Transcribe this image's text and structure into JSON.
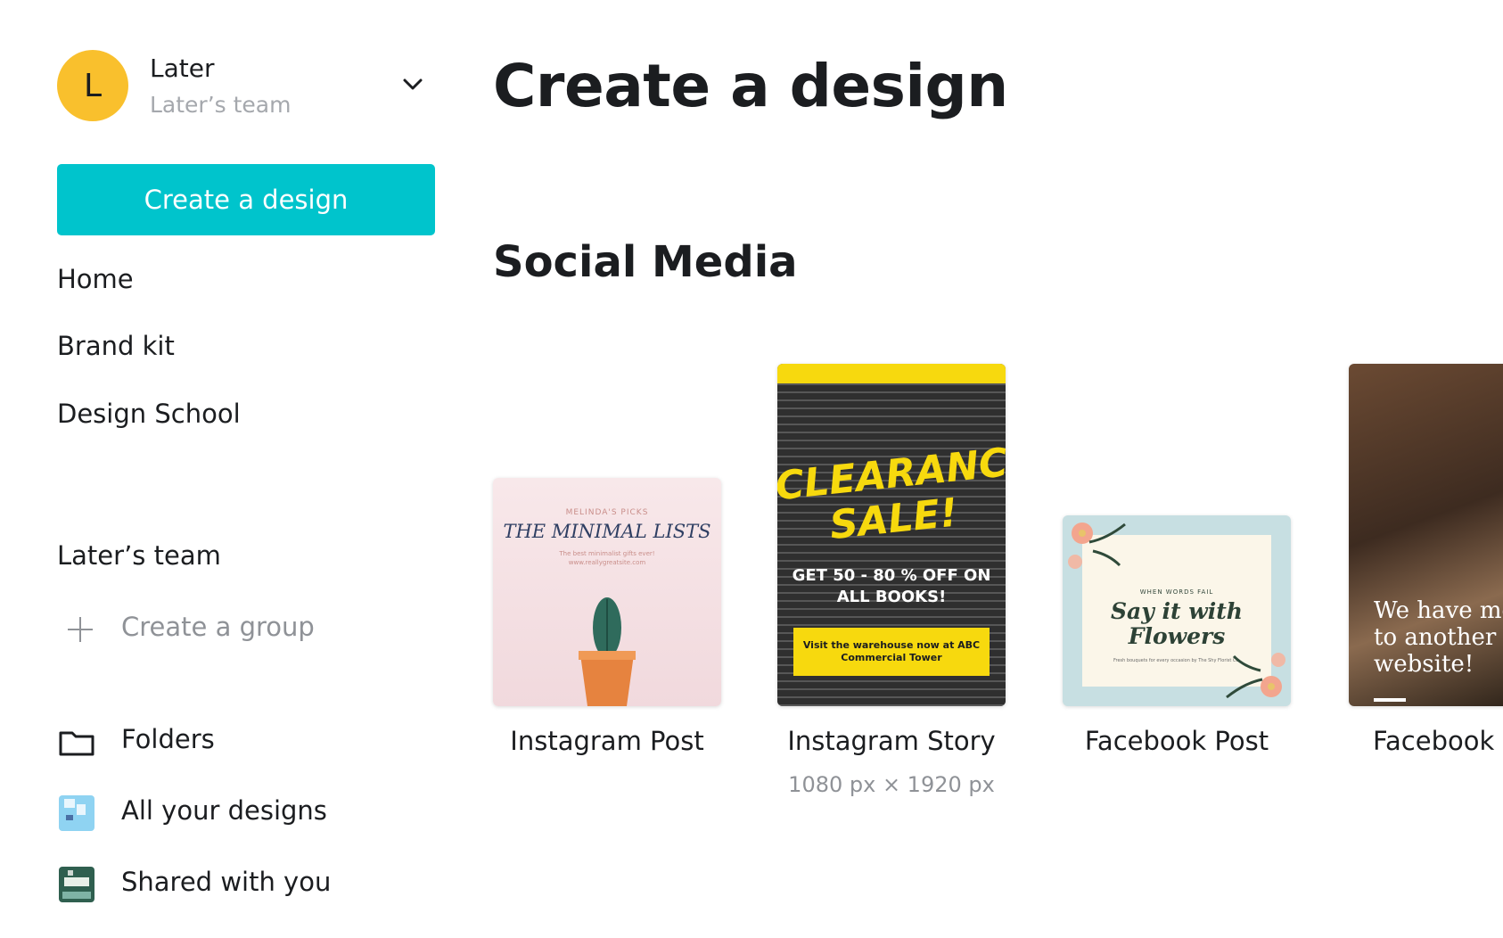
{
  "account": {
    "avatar_letter": "L",
    "name": "Later",
    "team": "Later’s team"
  },
  "sidebar": {
    "create_button": "Create a design",
    "nav": [
      "Home",
      "Brand kit",
      "Design School"
    ],
    "team_section_label": "Later’s team",
    "create_group": "Create a group",
    "library": [
      {
        "label": "Folders",
        "icon": "folder-icon"
      },
      {
        "label": "All your designs",
        "icon": "designs-thumbnail-icon"
      },
      {
        "label": "Shared with you",
        "icon": "shared-thumbnail-icon"
      }
    ]
  },
  "main": {
    "title": "Create a design",
    "section_title": "Social Media",
    "cards": [
      {
        "label": "Instagram Post",
        "thumb": {
          "pretitle": "MELINDA'S PICKS",
          "title": "THE MINIMAL LISTS",
          "subtitle": "The best minimalist gifts ever!",
          "url": "www.reallygreatsite.com"
        }
      },
      {
        "label": "Instagram Story",
        "sub": "1080 px × 1920 px",
        "thumb": {
          "headline": "CLEARANCE SALE!",
          "offer": "GET 50 - 80 % OFF ON ALL BOOKS!",
          "cta": "Visit the warehouse now at ABC Commercial Tower"
        }
      },
      {
        "label": "Facebook Post",
        "thumb": {
          "pretitle": "WHEN WORDS FAIL",
          "title": "Say it with Flowers",
          "subtitle": "Fresh bouquets for every occasion by The Shy Florist Co."
        }
      },
      {
        "label": "Facebook Story",
        "thumb": {
          "text": "We have moved to another website!"
        }
      }
    ]
  },
  "colors": {
    "accent": "#00c4cc",
    "avatar": "#f9c02d",
    "story_yellow": "#f7d90e",
    "muted_text": "#8f9297"
  }
}
